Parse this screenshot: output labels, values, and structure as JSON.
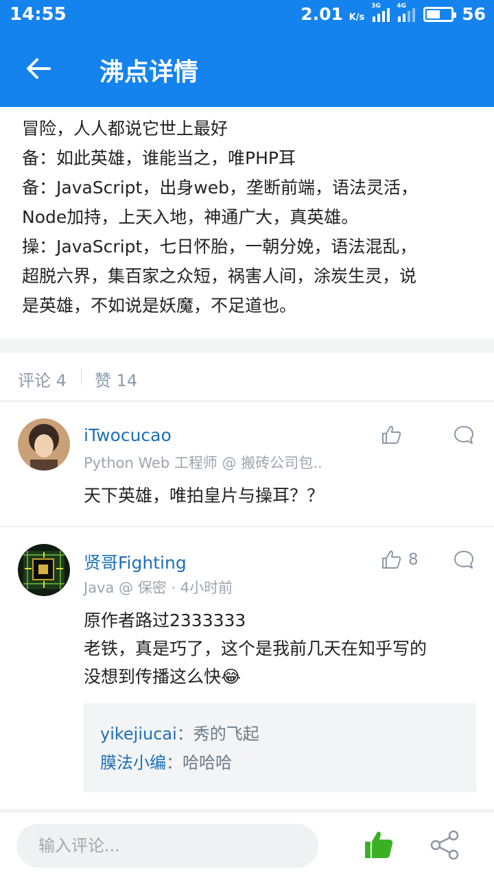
{
  "status": {
    "time": "14:55",
    "speed": "2.01",
    "speed_unit": "K/s",
    "sim1": "3G",
    "sim2": "4G",
    "battery": "56",
    "battery_level": 0.56
  },
  "appbar": {
    "title": "沸点详情"
  },
  "post": {
    "lines": [
      "冒险，人人都说它世上最好",
      "备：如此英雄，谁能当之，唯PHP耳",
      "备：JavaScript，出身web，垄断前端，语法灵活，",
      "Node加持，上天入地，神通广大，真英雄。",
      "操：JavaScript，七日怀胎，一朝分娩，语法混乱，",
      "超脱六界，集百家之众短，祸害人间，涂炭生灵，说",
      "是英雄，不如说是妖魔，不足道也。"
    ]
  },
  "tabs": {
    "comments": "评论 4",
    "likes": "赞 14"
  },
  "comments": [
    {
      "user": "iTwocucao",
      "meta": "Python Web 工程师 @ 搬砖公司包..",
      "body": [
        "天下英雄，唯拍皇片与操耳？？"
      ],
      "likes": ""
    },
    {
      "user": "贤哥Fighting",
      "meta": "Java @ 保密 · 4小时前",
      "body": [
        "原作者路过2333333",
        "老铁，真是巧了，这个是我前几天在知乎写的",
        "没想到传播这么快😂"
      ],
      "likes": "8",
      "replies": [
        {
          "user": "yikejiucai",
          "text": "：秀的飞起"
        },
        {
          "user": "膜法小编",
          "text": "：哈哈哈"
        }
      ]
    }
  ],
  "bottom": {
    "placeholder": "输入评论..."
  },
  "colors": {
    "brand": "#1483ed",
    "link": "#1d6fb8",
    "like_green": "#3cb025"
  },
  "icons": [
    "back-arrow-icon",
    "thumb-up-icon",
    "comment-bubble-icon",
    "share-icon",
    "signal-icon",
    "battery-icon"
  ]
}
